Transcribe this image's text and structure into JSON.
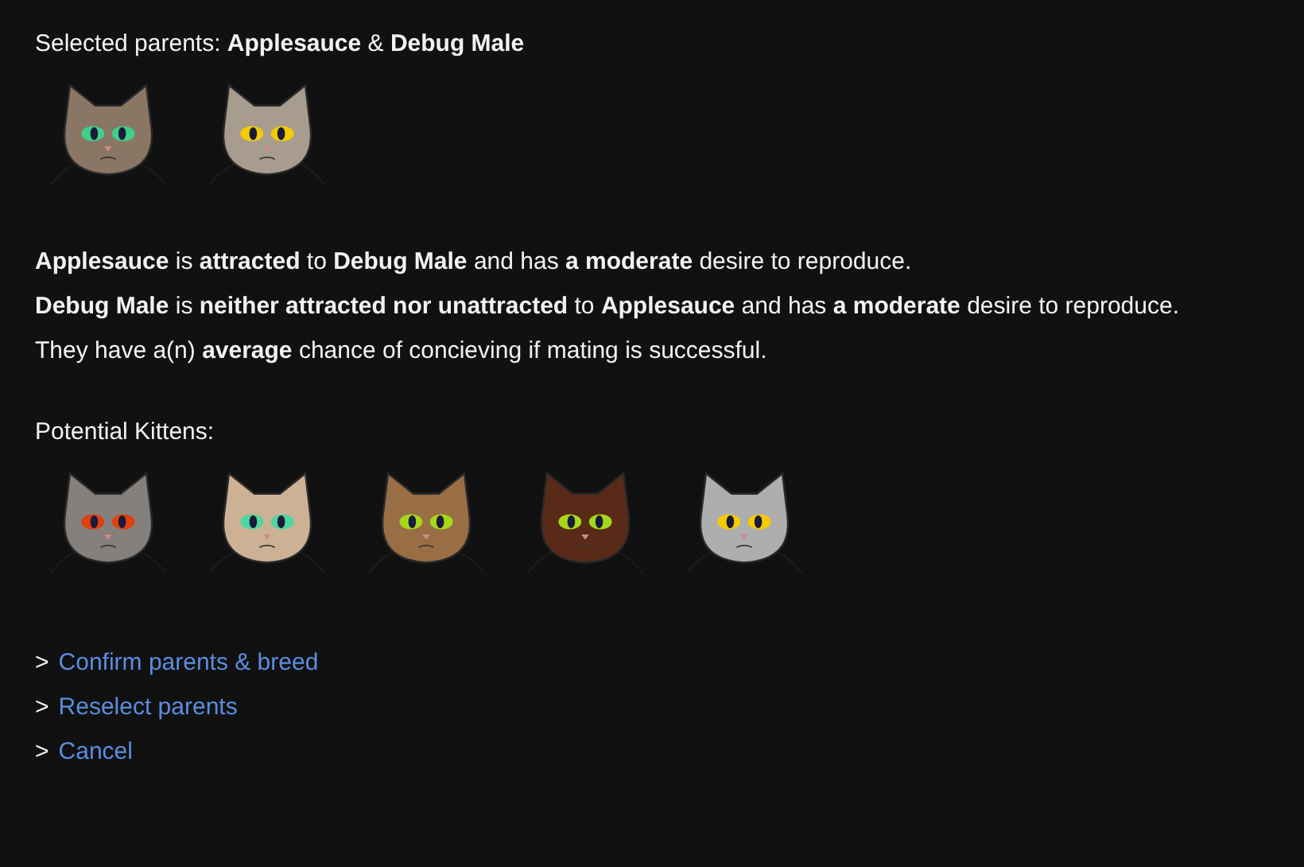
{
  "selected_line": "Selected parents: **Applesauce** & **Debug Male**",
  "parents": [
    {
      "color": "#8a7664"
    },
    {
      "color": "#a89c8e"
    }
  ],
  "description": [
    "**Applesauce** is **attracted** to **Debug Male** and has **a moderate** desire to reproduce.",
    "**Debug Male** is **neither attracted nor unattracted** to **Applesauce** and has **a moderate** desire to reproduce.",
    "They have a(n) **average** chance of concieving if mating is successful."
  ],
  "kittens_heading": "Potential Kittens:",
  "kittens": [
    {
      "color": "#85807c"
    },
    {
      "color": "#cdb195"
    },
    {
      "color": "#9a6e45"
    },
    {
      "color": "#5a2a18"
    },
    {
      "color": "#aeaeae"
    }
  ],
  "actions": [
    {
      "marker": ">",
      "label": "Confirm parents & breed"
    },
    {
      "marker": ">",
      "label": "Reselect parents"
    },
    {
      "marker": ">",
      "label": "Cancel"
    }
  ]
}
